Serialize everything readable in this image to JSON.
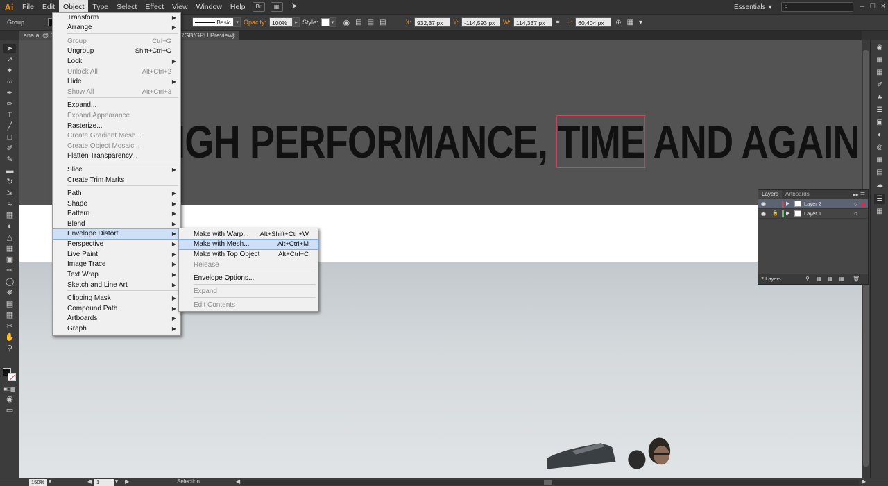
{
  "menubar": {
    "logo": "Ai",
    "items": [
      "File",
      "Edit",
      "Object",
      "Type",
      "Select",
      "Effect",
      "View",
      "Window",
      "Help"
    ],
    "bridge_label": "Br",
    "workspace": "Essentials",
    "search_placeholder": ""
  },
  "control": {
    "selection_type": "Group",
    "stroke_profile": "Basic",
    "opacity_label": "Opacity:",
    "opacity_value": "100%",
    "style_label": "Style:",
    "x_label": "X:",
    "x_value": "932,37 px",
    "y_label": "Y:",
    "y_value": "-114,593 px",
    "w_label": "W:",
    "w_value": "114,337 px",
    "h_label": "H:",
    "h_value": "60,404 px"
  },
  "document": {
    "tab_prefix": "ana.ai @ 66",
    "tab_suffix": "RGB/GPU Preview)",
    "close": "×"
  },
  "canvas": {
    "headline_before": "IGH PERFORMANCE, ",
    "headline_selected": "TIME",
    "headline_after": " AND AGAIN"
  },
  "object_menu": {
    "items": [
      {
        "label": "Transform",
        "shortcut": "",
        "submenu": true,
        "disabled": false
      },
      {
        "label": "Arrange",
        "shortcut": "",
        "submenu": true,
        "disabled": false
      },
      {
        "label": "Group",
        "shortcut": "Ctrl+G",
        "submenu": false,
        "disabled": true
      },
      {
        "label": "Ungroup",
        "shortcut": "Shift+Ctrl+G",
        "submenu": false,
        "disabled": false
      },
      {
        "label": "Lock",
        "shortcut": "",
        "submenu": true,
        "disabled": false
      },
      {
        "label": "Unlock All",
        "shortcut": "Alt+Ctrl+2",
        "submenu": false,
        "disabled": true
      },
      {
        "label": "Hide",
        "shortcut": "",
        "submenu": true,
        "disabled": false
      },
      {
        "label": "Show All",
        "shortcut": "Alt+Ctrl+3",
        "submenu": false,
        "disabled": true
      },
      {
        "label": "Expand...",
        "shortcut": "",
        "submenu": false,
        "disabled": false
      },
      {
        "label": "Expand Appearance",
        "shortcut": "",
        "submenu": false,
        "disabled": true
      },
      {
        "label": "Rasterize...",
        "shortcut": "",
        "submenu": false,
        "disabled": false
      },
      {
        "label": "Create Gradient Mesh...",
        "shortcut": "",
        "submenu": false,
        "disabled": true
      },
      {
        "label": "Create Object Mosaic...",
        "shortcut": "",
        "submenu": false,
        "disabled": true
      },
      {
        "label": "Flatten Transparency...",
        "shortcut": "",
        "submenu": false,
        "disabled": false
      },
      {
        "label": "Slice",
        "shortcut": "",
        "submenu": true,
        "disabled": false
      },
      {
        "label": "Create Trim Marks",
        "shortcut": "",
        "submenu": false,
        "disabled": false
      },
      {
        "label": "Path",
        "shortcut": "",
        "submenu": true,
        "disabled": false
      },
      {
        "label": "Shape",
        "shortcut": "",
        "submenu": true,
        "disabled": false
      },
      {
        "label": "Pattern",
        "shortcut": "",
        "submenu": true,
        "disabled": false
      },
      {
        "label": "Blend",
        "shortcut": "",
        "submenu": true,
        "disabled": false
      },
      {
        "label": "Envelope Distort",
        "shortcut": "",
        "submenu": true,
        "disabled": false
      },
      {
        "label": "Perspective",
        "shortcut": "",
        "submenu": true,
        "disabled": false
      },
      {
        "label": "Live Paint",
        "shortcut": "",
        "submenu": true,
        "disabled": false
      },
      {
        "label": "Image Trace",
        "shortcut": "",
        "submenu": true,
        "disabled": false
      },
      {
        "label": "Text Wrap",
        "shortcut": "",
        "submenu": true,
        "disabled": false
      },
      {
        "label": "Sketch and Line Art",
        "shortcut": "",
        "submenu": true,
        "disabled": false
      },
      {
        "label": "Clipping Mask",
        "shortcut": "",
        "submenu": true,
        "disabled": false
      },
      {
        "label": "Compound Path",
        "shortcut": "",
        "submenu": true,
        "disabled": false
      },
      {
        "label": "Artboards",
        "shortcut": "",
        "submenu": true,
        "disabled": false
      },
      {
        "label": "Graph",
        "shortcut": "",
        "submenu": true,
        "disabled": false
      }
    ]
  },
  "envelope_submenu": {
    "items": [
      {
        "label": "Make with Warp...",
        "shortcut": "Alt+Shift+Ctrl+W",
        "disabled": false
      },
      {
        "label": "Make with Mesh...",
        "shortcut": "Alt+Ctrl+M",
        "disabled": false
      },
      {
        "label": "Make with Top Object",
        "shortcut": "Alt+Ctrl+C",
        "disabled": false
      },
      {
        "label": "Release",
        "shortcut": "",
        "disabled": true
      },
      {
        "label": "Envelope Options...",
        "shortcut": "",
        "disabled": false
      },
      {
        "label": "Expand",
        "shortcut": "",
        "disabled": true
      },
      {
        "label": "Edit Contents",
        "shortcut": "",
        "disabled": true
      }
    ]
  },
  "layers_panel": {
    "tabs": [
      "Layers",
      "Artboards"
    ],
    "layers": [
      {
        "name": "Layer 2",
        "color": "#e03a54",
        "selected": true,
        "locked": false
      },
      {
        "name": "Layer 1",
        "color": "#4fcf5a",
        "selected": false,
        "locked": true
      }
    ],
    "footer": "2 Layers"
  },
  "status": {
    "zoom": "150%",
    "page": "1",
    "mode": "Selection"
  },
  "colors": {
    "accent_orange": "#e0903a",
    "selection_red": "#e03a54"
  }
}
